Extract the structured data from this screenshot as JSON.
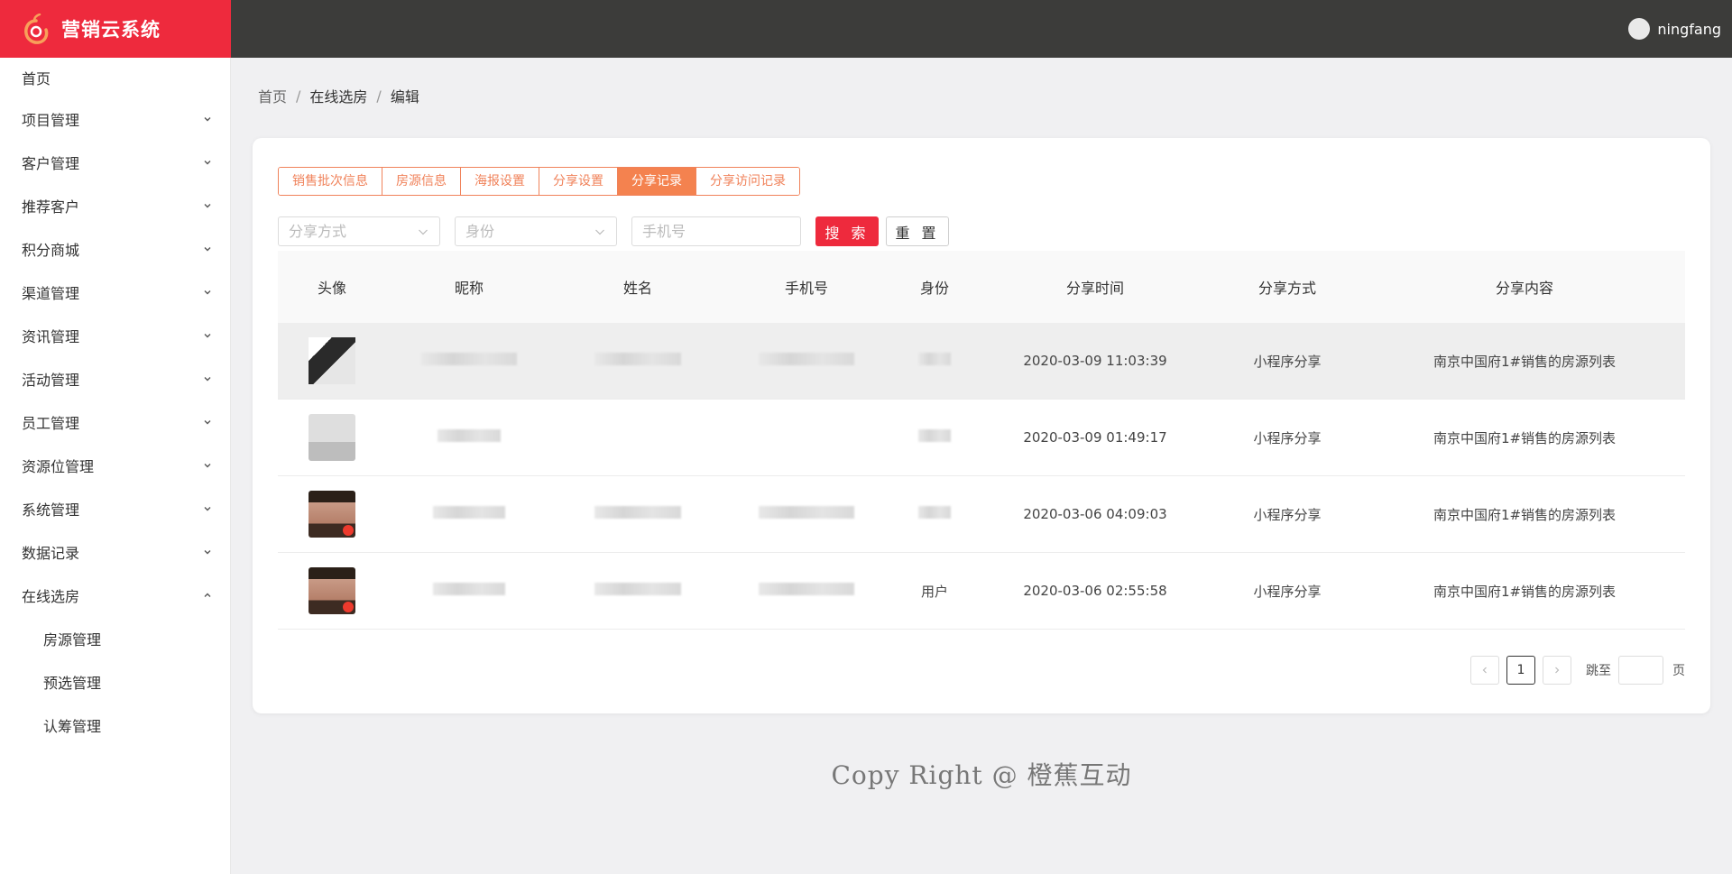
{
  "header": {
    "app_title": "营销云系统",
    "username": "ningfang",
    "brand_color": "#ee2a3d",
    "bar_color": "#3c3c3a"
  },
  "sidebar": {
    "items": [
      {
        "label": "首页"
      },
      {
        "label": "项目管理"
      },
      {
        "label": "客户管理"
      },
      {
        "label": "推荐客户"
      },
      {
        "label": "积分商城"
      },
      {
        "label": "渠道管理"
      },
      {
        "label": "资讯管理"
      },
      {
        "label": "活动管理"
      },
      {
        "label": "员工管理"
      },
      {
        "label": "资源位管理"
      },
      {
        "label": "系统管理"
      },
      {
        "label": "数据记录"
      },
      {
        "label": "在线选房"
      }
    ],
    "sub_items": [
      {
        "label": "房源管理"
      },
      {
        "label": "预选管理"
      },
      {
        "label": "认筹管理"
      }
    ]
  },
  "breadcrumb": {
    "home": "首页",
    "level2": "在线选房",
    "current": "编辑",
    "separator": "/"
  },
  "tabs": [
    {
      "label": "销售批次信息"
    },
    {
      "label": "房源信息"
    },
    {
      "label": "海报设置"
    },
    {
      "label": "分享设置"
    },
    {
      "label": "分享记录"
    },
    {
      "label": "分享访问记录"
    }
  ],
  "active_tab": "分享记录",
  "filters": {
    "share_method_placeholder": "分享方式",
    "identity_placeholder": "身份",
    "phone_placeholder": "手机号",
    "search_label": "搜 索",
    "reset_label": "重 置"
  },
  "table": {
    "columns": [
      "头像",
      "昵称",
      "姓名",
      "手机号",
      "身份",
      "分享时间",
      "分享方式",
      "分享内容"
    ],
    "rows": [
      {
        "identity": "",
        "time": "2020-03-09 11:03:39",
        "method": "小程序分享",
        "content": "南京中国府1#销售的房源列表"
      },
      {
        "identity": "",
        "time": "2020-03-09 01:49:17",
        "method": "小程序分享",
        "content": "南京中国府1#销售的房源列表"
      },
      {
        "identity": "",
        "time": "2020-03-06 04:09:03",
        "method": "小程序分享",
        "content": "南京中国府1#销售的房源列表"
      },
      {
        "identity": "用户",
        "time": "2020-03-06 02:55:58",
        "method": "小程序分享",
        "content": "南京中国府1#销售的房源列表"
      }
    ]
  },
  "pagination": {
    "current_page": "1",
    "jump_label": "跳至",
    "page_suffix": "页"
  },
  "footer": {
    "text": "Copy Right @ 橙蕉互动"
  }
}
